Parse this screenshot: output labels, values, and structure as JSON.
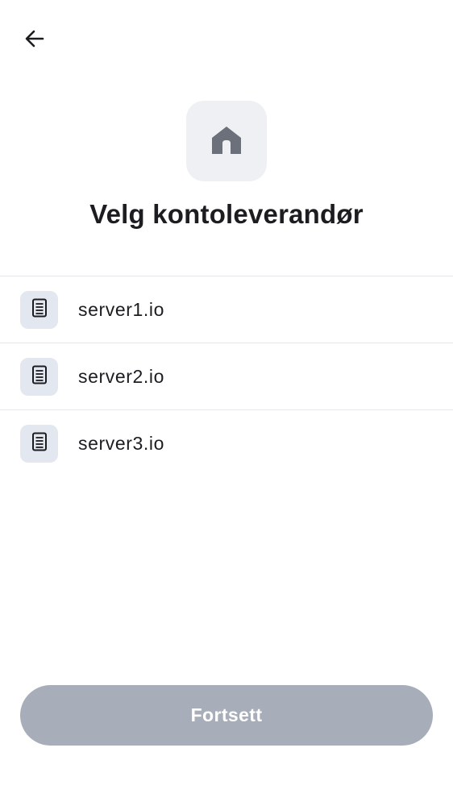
{
  "header": {
    "back_icon": "arrow-left-icon",
    "hero_icon": "home-icon",
    "title": "Velg kontoleverandør"
  },
  "providers": [
    {
      "label": "server1.io",
      "icon": "server-icon"
    },
    {
      "label": "server2.io",
      "icon": "server-icon"
    },
    {
      "label": "server3.io",
      "icon": "server-icon"
    }
  ],
  "footer": {
    "continue_label": "Fortsett",
    "continue_enabled": false
  },
  "colors": {
    "text": "#1c1c21",
    "hero_tile_bg": "#eff0f3",
    "hero_icon": "#6b707a",
    "server_tile_bg": "#e3e7ef",
    "divider": "#e6e7eb",
    "button_disabled_bg": "#a8aeb9",
    "button_text": "#ffffff"
  }
}
